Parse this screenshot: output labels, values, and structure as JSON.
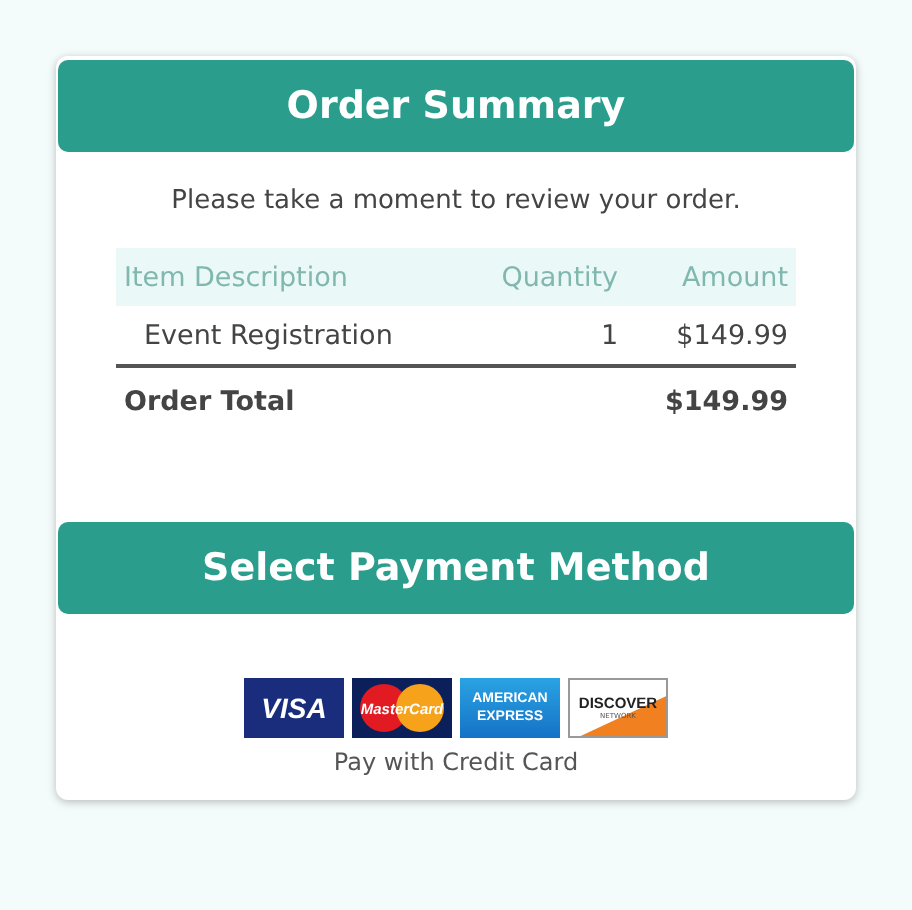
{
  "order_summary": {
    "title": "Order Summary",
    "intro": "Please take a moment to review your order.",
    "columns": [
      "Item Description",
      "Quantity",
      "Amount"
    ],
    "rows": [
      {
        "description": "Event Registration",
        "quantity": "1",
        "amount": "$149.99"
      }
    ],
    "total": {
      "label": "Order Total",
      "amount": "$149.99"
    }
  },
  "payment": {
    "title": "Select Payment Method",
    "cards": [
      {
        "kind": "visa",
        "text": "VISA"
      },
      {
        "kind": "mastercard",
        "text": "MasterCard"
      },
      {
        "kind": "amex",
        "text": "AMERICAN",
        "text_2": "EXPRESS"
      },
      {
        "kind": "discover",
        "text": "DISCOVER",
        "text_2": "NETWORK"
      }
    ],
    "caption": "Pay with Credit Card"
  }
}
